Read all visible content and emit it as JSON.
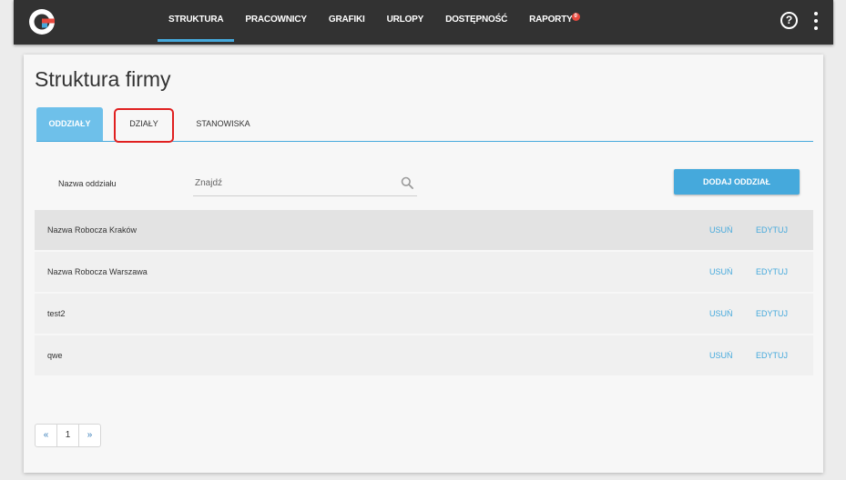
{
  "topbar": {
    "nav": [
      {
        "label": "STRUKTURA",
        "active": true
      },
      {
        "label": "PRACOWNICY",
        "active": false
      },
      {
        "label": "GRAFIKI",
        "active": false
      },
      {
        "label": "URLOPY",
        "active": false
      },
      {
        "label": "DOSTĘPNOŚĆ",
        "active": false
      },
      {
        "label": "RAPORTY",
        "active": false
      }
    ],
    "reports_badge": "0",
    "help_glyph": "?"
  },
  "page": {
    "title": "Struktura firmy"
  },
  "tabs": [
    {
      "label": "ODDZIAŁY",
      "active": true
    },
    {
      "label": "DZIAŁY",
      "active": false,
      "highlighted": true
    },
    {
      "label": "STANOWISKA",
      "active": false
    }
  ],
  "filter": {
    "label": "Nazwa oddziału",
    "search_placeholder": "Znajdź"
  },
  "add_button_label": "DODAJ ODDZIAŁ",
  "rows": [
    {
      "name": "Nazwa Robocza Kraków",
      "delete": "USUŃ",
      "edit": "EDYTUJ"
    },
    {
      "name": "Nazwa Robocza Warszawa",
      "delete": "USUŃ",
      "edit": "EDYTUJ"
    },
    {
      "name": "test2",
      "delete": "USUŃ",
      "edit": "EDYTUJ"
    },
    {
      "name": "qwe",
      "delete": "USUŃ",
      "edit": "EDYTUJ"
    }
  ],
  "pagination": {
    "prev": "«",
    "current": "1",
    "next": "»"
  },
  "colors": {
    "accent": "#45a9dc",
    "tab_active": "#6ec0ea",
    "topbar": "#323232",
    "highlight": "#e02020",
    "badge": "#e84a3f"
  }
}
